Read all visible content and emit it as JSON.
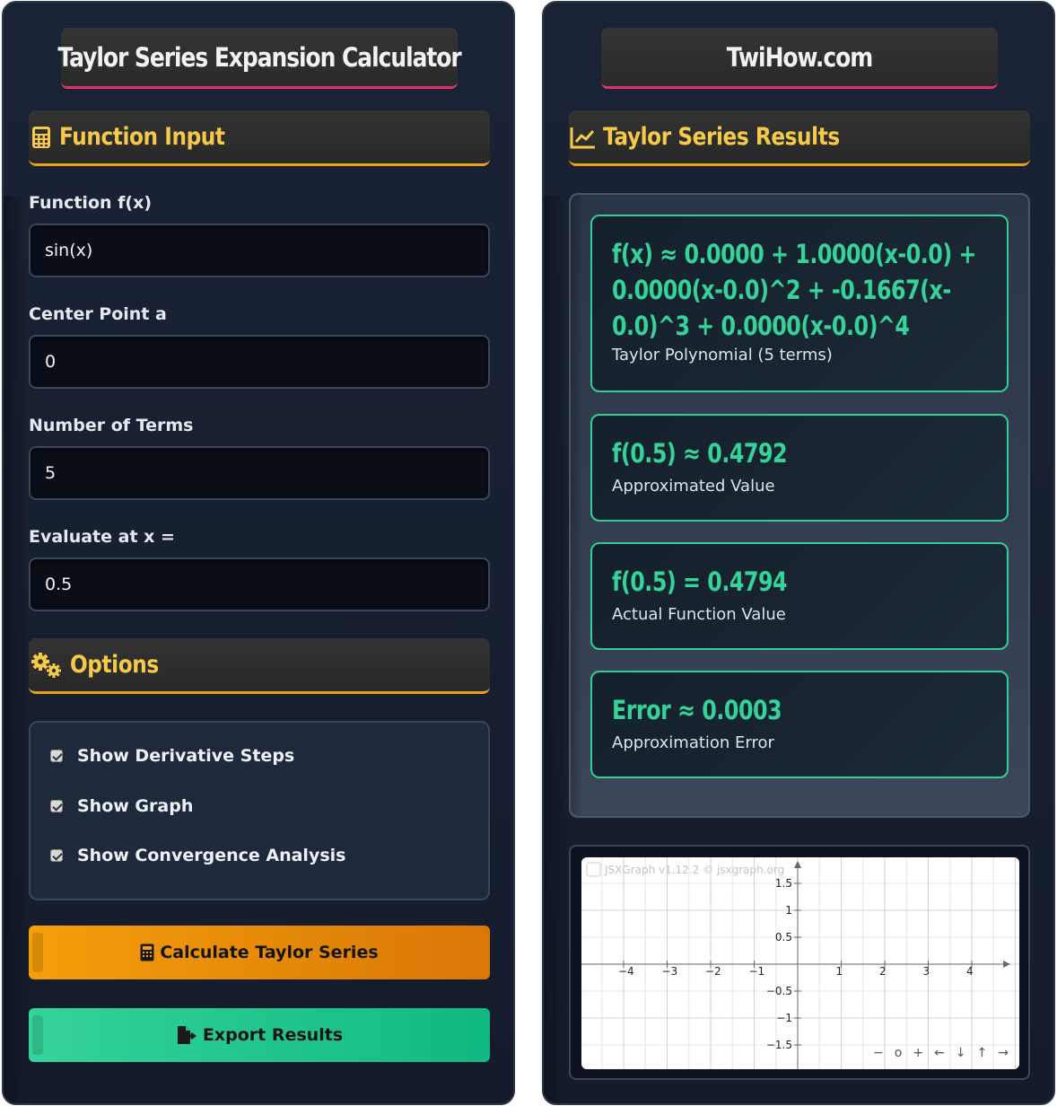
{
  "left": {
    "title": "Taylor Series Expansion Calculator",
    "function_input_header": "Function Input",
    "fields": [
      {
        "label": "Function f(x)",
        "value": "sin(x)"
      },
      {
        "label": "Center Point a",
        "value": "0"
      },
      {
        "label": "Number of Terms",
        "value": "5"
      },
      {
        "label": "Evaluate at x =",
        "value": "0.5"
      }
    ],
    "options_header": "Options",
    "options": [
      {
        "label": "Show Derivative Steps",
        "checked": true
      },
      {
        "label": "Show Graph",
        "checked": true
      },
      {
        "label": "Show Convergence Analysis",
        "checked": true
      }
    ],
    "calculate_label": "Calculate Taylor Series",
    "export_label": "Export Results"
  },
  "right": {
    "title": "TwiHow.com",
    "results_header": "Taylor Series Results",
    "results": [
      {
        "value": "f(x) ≈ 0.0000 + 1.0000(x-0.0) + 0.0000(x-0.0)^2 + -0.1667(x-0.0)^3 + 0.0000(x-0.0)^4",
        "label": "Taylor Polynomial (5 terms)"
      },
      {
        "value": "f(0.5) ≈ 0.4792",
        "label": "Approximated Value"
      },
      {
        "value": "f(0.5) = 0.4794",
        "label": "Actual Function Value"
      },
      {
        "value": "Error ≈ 0.0003",
        "label": "Approximation Error"
      }
    ],
    "graph": {
      "watermark": "JSXGraph v1.12.2 © jsxgraph.org",
      "x_ticks": [
        "−4",
        "−3",
        "−2",
        "−1",
        "1",
        "2",
        "3",
        "4"
      ],
      "y_ticks": [
        "1.5",
        "1",
        "0.5",
        "−0.5",
        "−1",
        "−1.5"
      ],
      "nav": [
        "−",
        "o",
        "+",
        "←",
        "↓",
        "↑",
        "→"
      ]
    }
  },
  "colors": {
    "accent_yellow": "#f7c948",
    "accent_green": "#34d399",
    "accent_pink": "#e0306f",
    "accent_orange": "#e8a019"
  }
}
